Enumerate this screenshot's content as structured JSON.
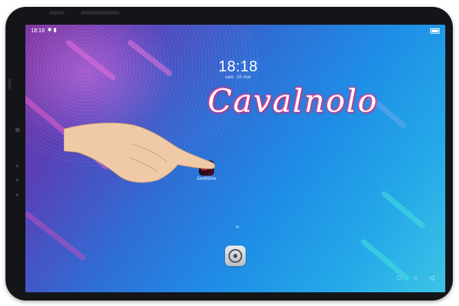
{
  "status_bar": {
    "time": "18:18",
    "icons": "✱ ▮",
    "battery_icon": "battery-icon"
  },
  "lock": {
    "clock": "18:18",
    "date": "sam. 10 mai"
  },
  "wallpaper": {
    "logo_text": "Cavalnolo"
  },
  "apps": [
    {
      "label": "ZenithOne",
      "icon": "zenithone-app-icon"
    }
  ],
  "dock": {
    "chevron": "^",
    "settings_icon": "settings-gear-icon"
  },
  "nav": {
    "recents": "□",
    "home": "○",
    "back": "◁"
  },
  "colors": {
    "bezel": "#141518",
    "accent_logo": "#e0206f",
    "bg_start": "#7a2f9a",
    "bg_end": "#3cc4e6"
  }
}
